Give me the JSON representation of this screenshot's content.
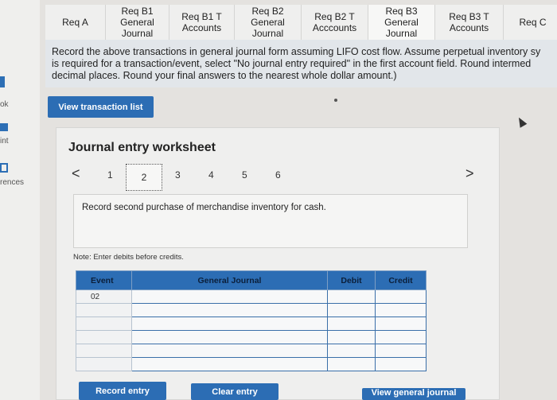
{
  "sidebar": {
    "items": [
      {
        "label": "ok",
        "icon": "book-icon"
      },
      {
        "label": "int",
        "icon": "print-icon"
      },
      {
        "label": "rences",
        "icon": "references-icon"
      }
    ]
  },
  "tabs": [
    {
      "label": "Req A"
    },
    {
      "label": "Req B1\nGeneral\nJournal"
    },
    {
      "label": "Req B1 T\nAccounts"
    },
    {
      "label": "Req B2\nGeneral\nJournal"
    },
    {
      "label": "Req B2 T\nAcccounts"
    },
    {
      "label": "Req B3\nGeneral\nJournal"
    },
    {
      "label": "Req B3 T\nAccounts"
    },
    {
      "label": "Req C"
    }
  ],
  "instructions": "Record the above transactions in general journal form assuming LIFO cost flow. Assume perpetual inventory sy\nis required for a transaction/event, select \"No journal entry required\" in the first account field. Round intermed\ndecimal places. Round your final answers to the nearest whole dollar amount.)",
  "view_transaction_label": "View transaction list",
  "worksheet": {
    "title": "Journal entry worksheet",
    "pages": [
      "1",
      "2",
      "3",
      "4",
      "5",
      "6"
    ],
    "active_page": "2",
    "prev_glyph": "<",
    "next_glyph": ">",
    "description": "Record second purchase of merchandise inventory for cash.",
    "note": "Note: Enter debits before credits."
  },
  "table": {
    "headers": {
      "event": "Event",
      "general_journal": "General Journal",
      "debit": "Debit",
      "credit": "Credit"
    },
    "rows": [
      {
        "event": "02"
      },
      {
        "event": ""
      },
      {
        "event": ""
      },
      {
        "event": ""
      },
      {
        "event": ""
      },
      {
        "event": ""
      }
    ]
  },
  "buttons": {
    "record": "Record entry",
    "clear": "Clear entry",
    "view_journal": "View general journal"
  },
  "colors": {
    "accent": "#2c6db4"
  }
}
